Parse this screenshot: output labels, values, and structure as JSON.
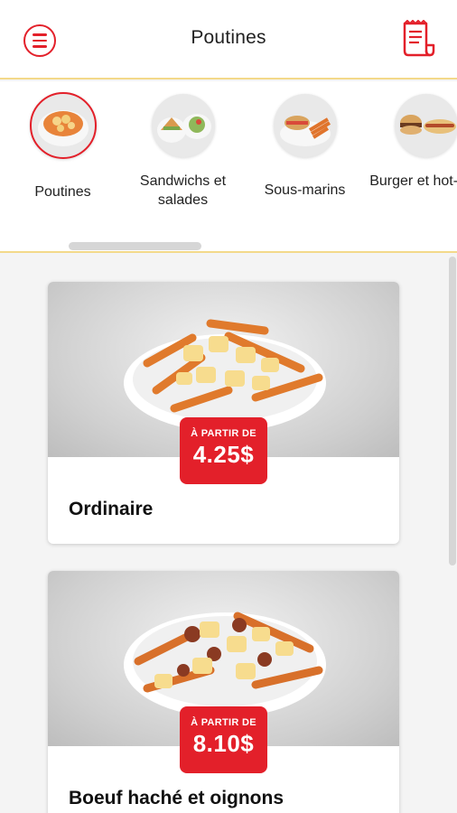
{
  "header": {
    "title": "Poutines"
  },
  "categories": [
    {
      "label": "Poutines",
      "active": true
    },
    {
      "label": "Sandwichs et salades",
      "active": false
    },
    {
      "label": "Sous-marins",
      "active": false
    },
    {
      "label": "Burger et hot-dog",
      "active": false
    }
  ],
  "products": [
    {
      "name": "Ordinaire",
      "price_prefix": "À PARTIR DE",
      "price": "4.25$"
    },
    {
      "name": "Boeuf haché et oignons",
      "price_prefix": "À PARTIR DE",
      "price": "8.10$"
    }
  ],
  "colors": {
    "accent": "#e3202a",
    "divider": "#f3d98a"
  }
}
